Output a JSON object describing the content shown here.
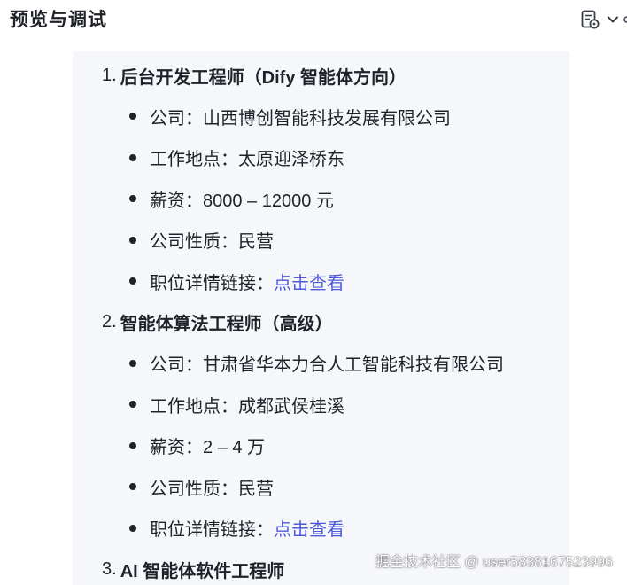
{
  "header": {
    "title": "预览与调试",
    "tool_icon": "document-settings-icon",
    "dropdown_icon": "chevron-down-icon"
  },
  "jobs": [
    {
      "number": "1.",
      "title": "后台开发工程师（Dify 智能体方向）",
      "details": [
        {
          "label": "公司：",
          "value": "山西博创智能科技发展有限公司"
        },
        {
          "label": "工作地点：",
          "value": "太原迎泽桥东"
        },
        {
          "label": "薪资：",
          "value": "8000 – 12000 元"
        },
        {
          "label": "公司性质：",
          "value": "民营"
        },
        {
          "label": "职位详情链接：",
          "value": "点击查看"
        }
      ]
    },
    {
      "number": "2.",
      "title": "智能体算法工程师（高级）",
      "details": [
        {
          "label": "公司：",
          "value": "甘肃省华本力合人工智能科技有限公司"
        },
        {
          "label": "工作地点：",
          "value": "成都武侯桂溪"
        },
        {
          "label": "薪资：",
          "value": "2 – 4 万"
        },
        {
          "label": "公司性质：",
          "value": "民营"
        },
        {
          "label": "职位详情链接：",
          "value": "点击查看"
        }
      ]
    },
    {
      "number": "3.",
      "title": "AI 智能体软件工程师"
    }
  ],
  "watermark": "掘金技术社区 @ user5838167523996",
  "colors": {
    "text": "#1f2329",
    "link": "#4e5ad8",
    "panel_background": "#f6f7fb"
  }
}
